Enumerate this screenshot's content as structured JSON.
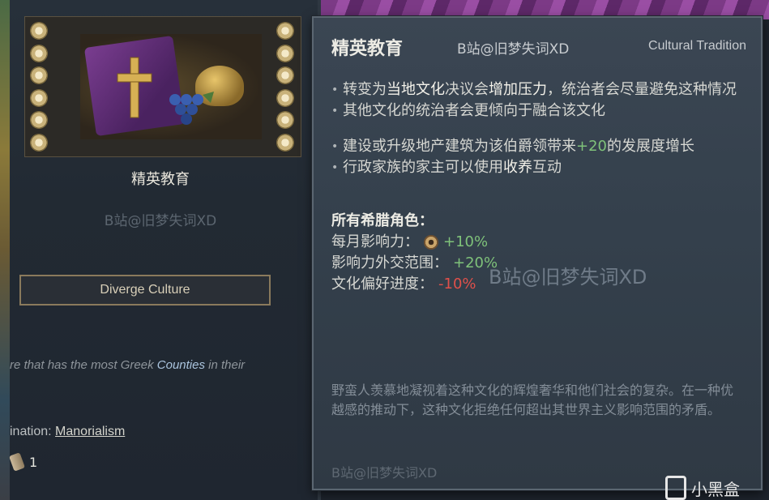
{
  "left_panel": {
    "tradition_name": "精英教育",
    "watermark": "B站@旧梦失词XD",
    "diverge_button": "Diverge Culture",
    "requirement_text_prefix": "re that has the most Greek ",
    "requirement_link": "Counties",
    "requirement_text_suffix": " in their",
    "innovation_label": "ination: ",
    "innovation_value": "Manorialism",
    "count": "1"
  },
  "tooltip": {
    "title": "精英教育",
    "watermark_top": "B站@旧梦失词XD",
    "type_label": "Cultural Tradition",
    "bullets": [
      {
        "pre": "转变为",
        "hl1": "当地文化",
        "mid": "决议会",
        "hl2": "增加压力",
        "post": "，统治者会尽量避免这种情况"
      },
      {
        "text": "其他文化的统治者会更倾向于融合该文化"
      },
      {
        "pre": "建设或升级地产建筑为该伯爵领带来",
        "value": "+20",
        "post": "的发展度增长"
      },
      {
        "pre": "行政家族的家主可以使用",
        "hl": "收养",
        "post": "互动"
      }
    ],
    "section_head": "所有希腊角色：",
    "modifiers": [
      {
        "label": "每月影响力：",
        "icon": "influence-icon",
        "value": "+10%"
      },
      {
        "label": "影响力外交范围：",
        "value": "+20%"
      },
      {
        "label": "文化偏好进度：",
        "value": "-10%"
      }
    ],
    "watermark_middle": "B站@旧梦失词XD",
    "flavor_text": "野蛮人羡慕地凝视着这种文化的辉煌奢华和他们社会的复杂。在一种优越感的推动下，这种文化拒绝任何超出其世界主义影响范围的矛盾。",
    "watermark_bottom": "B站@旧梦失词XD"
  },
  "brand": {
    "name": "小黑盒"
  },
  "colors": {
    "positive": "#7fc27a",
    "negative": "#e0504a",
    "link": "#aac4de"
  }
}
